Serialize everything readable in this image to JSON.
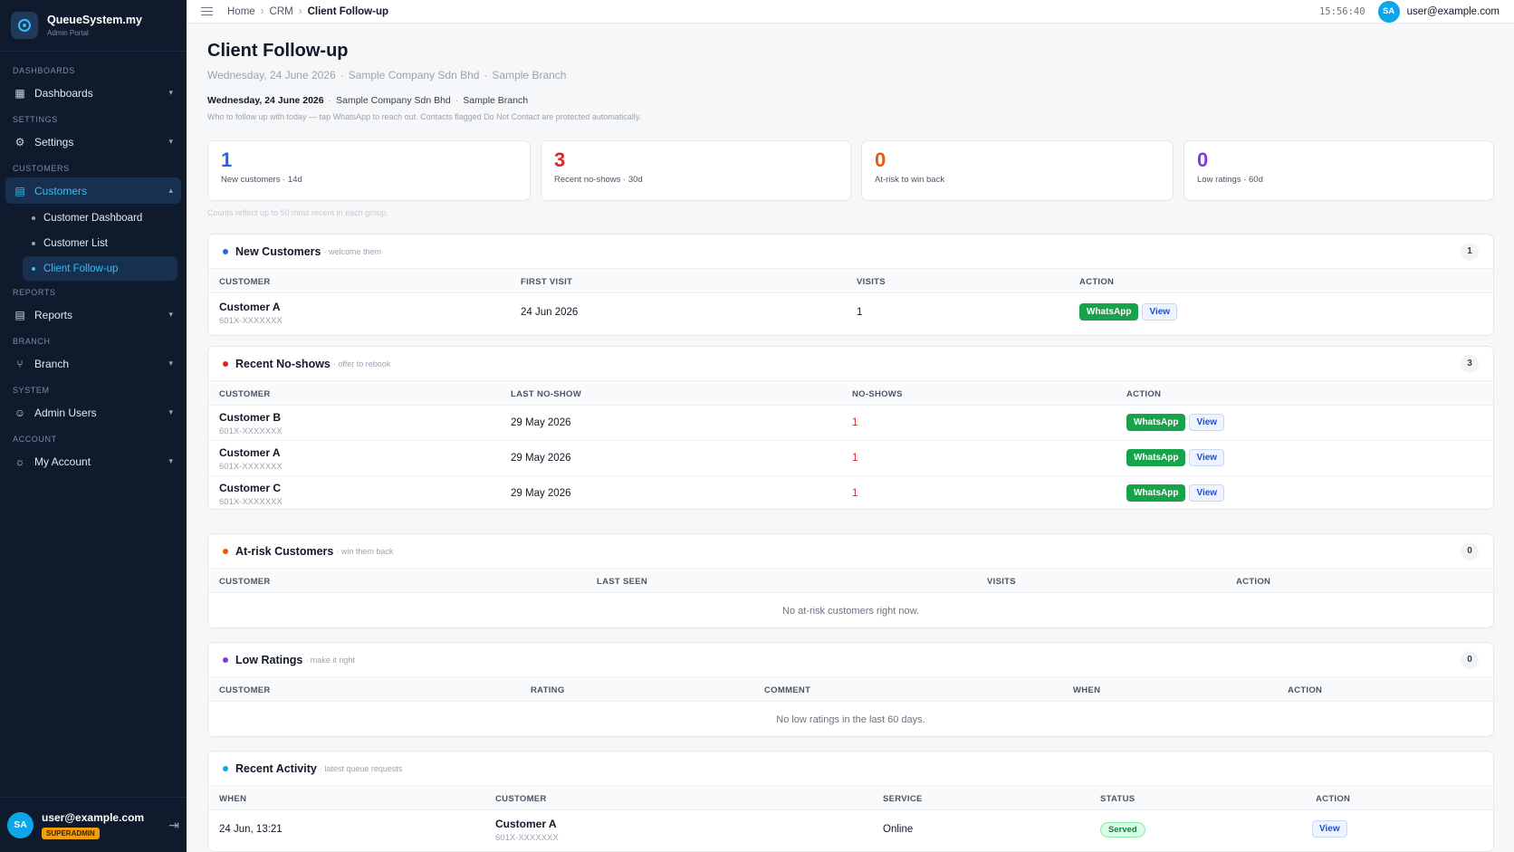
{
  "brand": {
    "name": "QueueSystem.my",
    "subtitle": "Admin Portal"
  },
  "sidebar": {
    "sections": [
      {
        "label": "DASHBOARDS",
        "item": "Dashboards"
      },
      {
        "label": "SETTINGS",
        "item": "Settings"
      },
      {
        "label": "CUSTOMERS",
        "item": "Customers"
      },
      {
        "label": "REPORTS",
        "item": "Reports"
      },
      {
        "label": "BRANCH",
        "item": "Branch"
      },
      {
        "label": "SYSTEM",
        "item": "Admin Users"
      },
      {
        "label": "ACCOUNT",
        "item": "My Account"
      }
    ],
    "customer_subitems": [
      "Customer Dashboard",
      "Customer List",
      "Client Follow-up"
    ],
    "user_email": "user@example.com",
    "user_initials": "SA",
    "user_role": "SUPERADMIN"
  },
  "topbar": {
    "breadcrumb": [
      "Home",
      "CRM",
      "Client Follow-up"
    ],
    "clock": "15:56:40",
    "user_initials": "SA",
    "user_email": "user@example.com"
  },
  "page": {
    "title": "Client Follow-up",
    "date": "Wednesday, 24 June 2026",
    "company": "Sample Company Sdn Bhd",
    "branch": "Sample Branch",
    "hint": "Who to follow up with today — tap WhatsApp to reach out. Contacts flagged Do Not Contact are protected automatically.",
    "counts_note": "Counts reflect up to 50 most recent in each group."
  },
  "cards": [
    {
      "value": "1",
      "label": "New customers · 14d",
      "color": "#2563eb"
    },
    {
      "value": "3",
      "label": "Recent no-shows · 30d",
      "color": "#dc2626"
    },
    {
      "value": "0",
      "label": "At-risk to win back",
      "color": "#ea580c"
    },
    {
      "value": "0",
      "label": "Low ratings · 60d",
      "color": "#7c3aed"
    }
  ],
  "new_customers": {
    "title": "New Customers",
    "subtitle": "· welcome them",
    "count": "1",
    "dot": "#2563eb",
    "headers": [
      "CUSTOMER",
      "FIRST VISIT",
      "VISITS",
      "ACTION"
    ],
    "rows": [
      {
        "name": "Customer A",
        "phone": "601X-XXXXXXX",
        "first_visit": "24 Jun 2026",
        "visits": "1"
      }
    ]
  },
  "no_shows": {
    "title": "Recent No-shows",
    "subtitle": "· offer to rebook",
    "count": "3",
    "dot": "#dc2626",
    "headers": [
      "CUSTOMER",
      "LAST NO-SHOW",
      "NO-SHOWS",
      "ACTION"
    ],
    "rows": [
      {
        "name": "Customer B",
        "phone": "601X-XXXXXXX",
        "last": "29 May 2026",
        "count": "1"
      },
      {
        "name": "Customer A",
        "phone": "601X-XXXXXXX",
        "last": "29 May 2026",
        "count": "1"
      },
      {
        "name": "Customer C",
        "phone": "601X-XXXXXXX",
        "last": "29 May 2026",
        "count": "1"
      }
    ]
  },
  "at_risk": {
    "title": "At-risk Customers",
    "subtitle": "· win them back",
    "count": "0",
    "dot": "#ea580c",
    "headers": [
      "CUSTOMER",
      "LAST SEEN",
      "VISITS",
      "ACTION"
    ],
    "empty": "No at-risk customers right now."
  },
  "low_ratings": {
    "title": "Low Ratings",
    "subtitle": "· make it right",
    "count": "0",
    "dot": "#7c3aed",
    "headers": [
      "CUSTOMER",
      "RATING",
      "COMMENT",
      "WHEN",
      "ACTION"
    ],
    "empty": "No low ratings in the last 60 days."
  },
  "activity": {
    "title": "Recent Activity",
    "subtitle": "· latest queue requests",
    "dot": "#0ea5e9",
    "headers": [
      "WHEN",
      "CUSTOMER",
      "SERVICE",
      "STATUS",
      "ACTION"
    ],
    "rows": [
      {
        "when": "24 Jun, 13:21",
        "name": "Customer A",
        "phone": "601X-XXXXXXX",
        "service": "Online",
        "status": "Served"
      }
    ]
  },
  "actions": {
    "whatsapp": "WhatsApp",
    "view": "View"
  }
}
